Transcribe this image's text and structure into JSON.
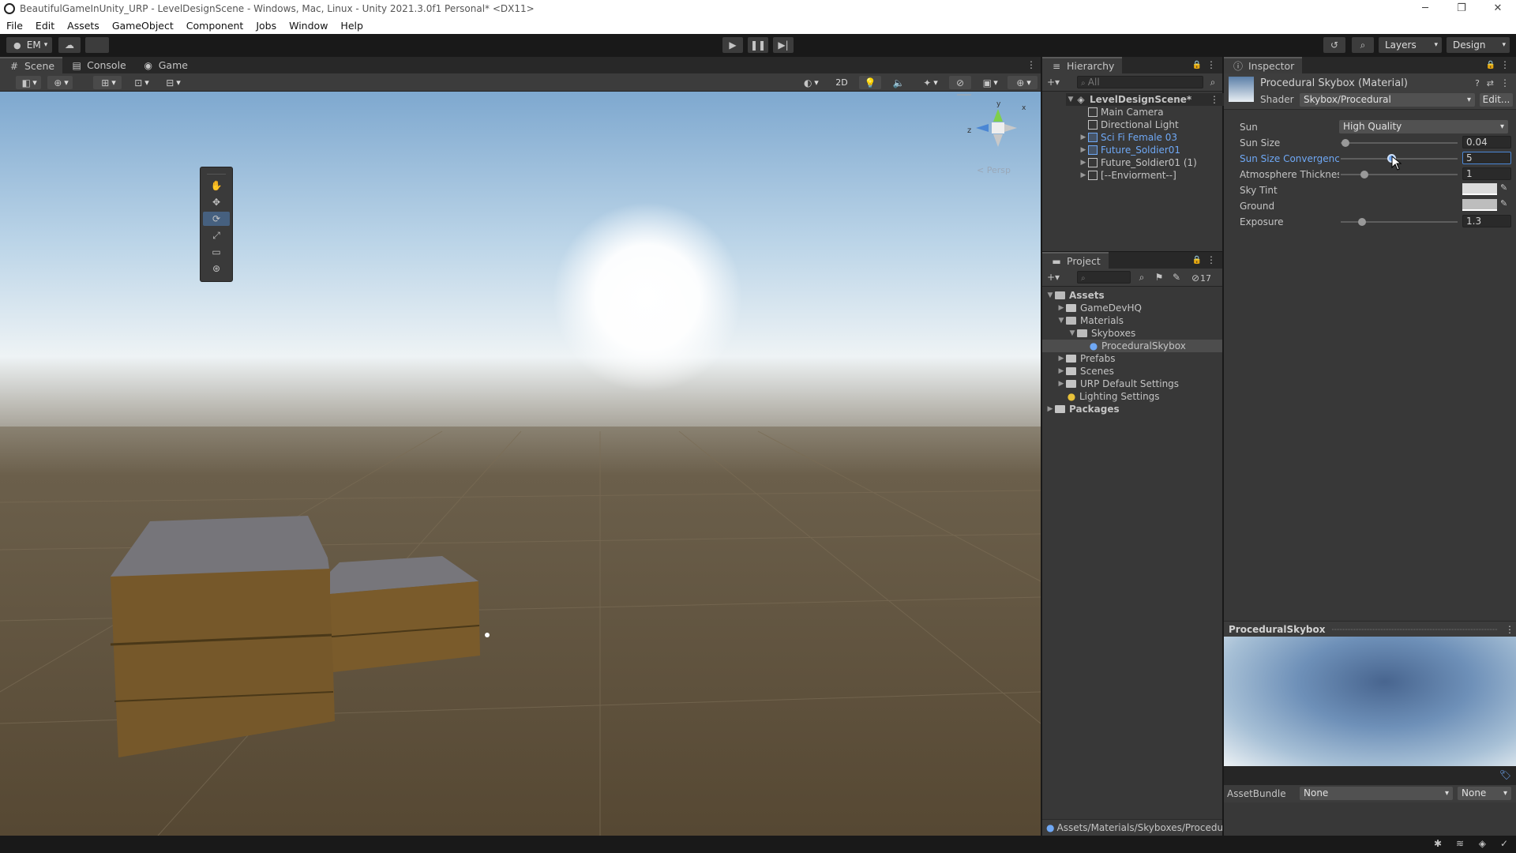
{
  "window": {
    "title": "BeautifulGameInUnity_URP - LevelDesignScene - Windows, Mac, Linux - Unity 2021.3.0f1 Personal* <DX11>",
    "minimize": "─",
    "maximize": "❐",
    "close": "✕"
  },
  "menu": [
    "File",
    "Edit",
    "Assets",
    "GameObject",
    "Component",
    "Jobs",
    "Window",
    "Help"
  ],
  "toolbar": {
    "account": "EM",
    "layers": "Layers",
    "layout": "Design"
  },
  "scene_panel": {
    "tabs": [
      "Scene",
      "Console",
      "Game"
    ],
    "toggle_2d": "2D",
    "gizmo_label": "< Persp"
  },
  "hierarchy": {
    "tab": "Hierarchy",
    "search_placeholder": "All",
    "scene": "LevelDesignScene*",
    "items": [
      {
        "label": "Main Camera",
        "prefab": false,
        "expandable": false
      },
      {
        "label": "Directional Light",
        "prefab": false,
        "expandable": false
      },
      {
        "label": "Sci Fi Female 03",
        "prefab": true,
        "expandable": true
      },
      {
        "label": "Future_Soldier01",
        "prefab": true,
        "expandable": true
      },
      {
        "label": "Future_Soldier01 (1)",
        "prefab": false,
        "expandable": true
      },
      {
        "label": "[--Enviorment--]",
        "prefab": false,
        "expandable": true
      }
    ]
  },
  "project": {
    "tab": "Project",
    "hidden_count": "17",
    "tree": [
      {
        "label": "Assets",
        "depth": 0,
        "state": "open",
        "bold": true,
        "kind": "folder"
      },
      {
        "label": "GameDevHQ",
        "depth": 1,
        "state": "closed",
        "bold": false,
        "kind": "folder"
      },
      {
        "label": "Materials",
        "depth": 1,
        "state": "open",
        "bold": false,
        "kind": "folder"
      },
      {
        "label": "Skyboxes",
        "depth": 2,
        "state": "open",
        "bold": false,
        "kind": "folder"
      },
      {
        "label": "ProceduralSkybox",
        "depth": 3,
        "state": "none",
        "bold": false,
        "kind": "material",
        "selected": true
      },
      {
        "label": "Prefabs",
        "depth": 1,
        "state": "closed",
        "bold": false,
        "kind": "folder"
      },
      {
        "label": "Scenes",
        "depth": 1,
        "state": "closed",
        "bold": false,
        "kind": "folder"
      },
      {
        "label": "URP Default Settings",
        "depth": 1,
        "state": "closed",
        "bold": false,
        "kind": "folder"
      },
      {
        "label": "Lighting Settings",
        "depth": 1,
        "state": "none",
        "bold": false,
        "kind": "lighting"
      },
      {
        "label": "Packages",
        "depth": 0,
        "state": "closed",
        "bold": true,
        "kind": "folder"
      }
    ],
    "footer_path": "Assets/Materials/Skyboxes/Procedu"
  },
  "inspector": {
    "tab": "Inspector",
    "title": "Procedural Skybox (Material)",
    "shader_label": "Shader",
    "shader_value": "Skybox/Procedural",
    "edit_button": "Edit...",
    "props": {
      "sun_label": "Sun",
      "sun_value": "High Quality",
      "sun_size_label": "Sun Size",
      "sun_size_value": "0.04",
      "sun_size_slider": 0.04,
      "convergence_label": "Sun Size Convergence",
      "convergence_value": "5",
      "convergence_slider": 0.43,
      "thickness_label": "Atmosphere Thickness",
      "thickness_value": "1",
      "thickness_slider": 0.2,
      "sky_tint_label": "Sky Tint",
      "ground_label": "Ground",
      "exposure_label": "Exposure",
      "exposure_value": "1.3",
      "exposure_slider": 0.18
    },
    "preview_title": "ProceduralSkybox",
    "asset_bundle_label": "AssetBundle",
    "asset_bundle_value": "None",
    "asset_bundle_variant": "None"
  },
  "colors": {
    "accent": "#4a87d6",
    "prefab_blue": "#6fa8f5",
    "panel": "#383838",
    "ground": "#5b4e3a"
  }
}
